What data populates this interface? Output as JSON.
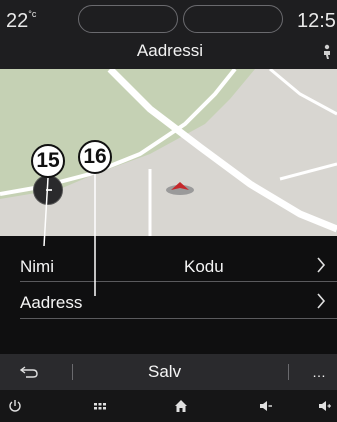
{
  "status_bar": {
    "temperature": "22",
    "temperature_unit": "°c",
    "clock": "12:5"
  },
  "header": {
    "title": "Aadressi"
  },
  "map": {
    "zoom_button_icon": "minus-icon",
    "position_marker_icon": "navigation-arrow-icon",
    "colors": {
      "background": "#d8d6d1",
      "park": "#c5d1b4",
      "road": "#ffffff"
    }
  },
  "callouts": {
    "first": "15",
    "second": "16"
  },
  "list": {
    "rows": [
      {
        "label": "Nimi",
        "value": "Kodu",
        "icon": "chevron-right-icon"
      },
      {
        "label": "Aadress",
        "value": "",
        "icon": "chevron-right-icon"
      }
    ]
  },
  "action_bar": {
    "back_icon": "back-arrow-icon",
    "save_label": "Salv",
    "more_label": "…",
    "more_icon": "more-icon"
  },
  "bottom_nav": {
    "icons": [
      "power-icon",
      "apps-grid-icon",
      "home-icon",
      "volume-down-icon",
      "volume-up-icon"
    ]
  }
}
